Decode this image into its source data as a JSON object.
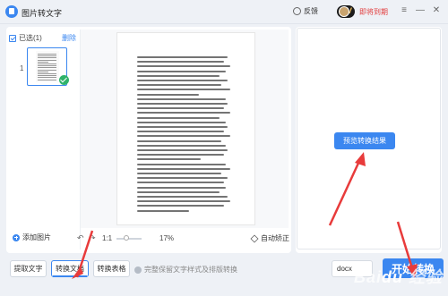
{
  "app": {
    "title": "图片转文字",
    "feedback_label": "反馈",
    "expire_text": "即将到期"
  },
  "window_controls": {
    "menu": "≡",
    "minimize": "—",
    "close": "✕"
  },
  "file_list": {
    "selected_label": "已选(1)",
    "delete_label": "删除",
    "page_index": "1"
  },
  "toolbar": {
    "add_image_label": "添加图片",
    "rotate_left": "↶",
    "rotate_right": "↷",
    "ratio_label": "1:1",
    "zoom_value": "17%",
    "zoom_fraction": 0.17,
    "auto_correct_label": "自动矫正"
  },
  "result": {
    "preview_button": "预览转换结果"
  },
  "modes": {
    "tabs": [
      {
        "label": "提取文字"
      },
      {
        "label": "转换文档"
      },
      {
        "label": "转换表格"
      }
    ],
    "active": "转换文档",
    "hint": "完整保留文字样式及排版转换"
  },
  "output": {
    "format_value": "docx",
    "start_button": "开始转换"
  },
  "watermark": "Baidu经验",
  "colors": {
    "accent": "#3b87f0",
    "arrow": "#e83b3b",
    "success": "#2fb36a",
    "expire": "#e23c3c"
  }
}
